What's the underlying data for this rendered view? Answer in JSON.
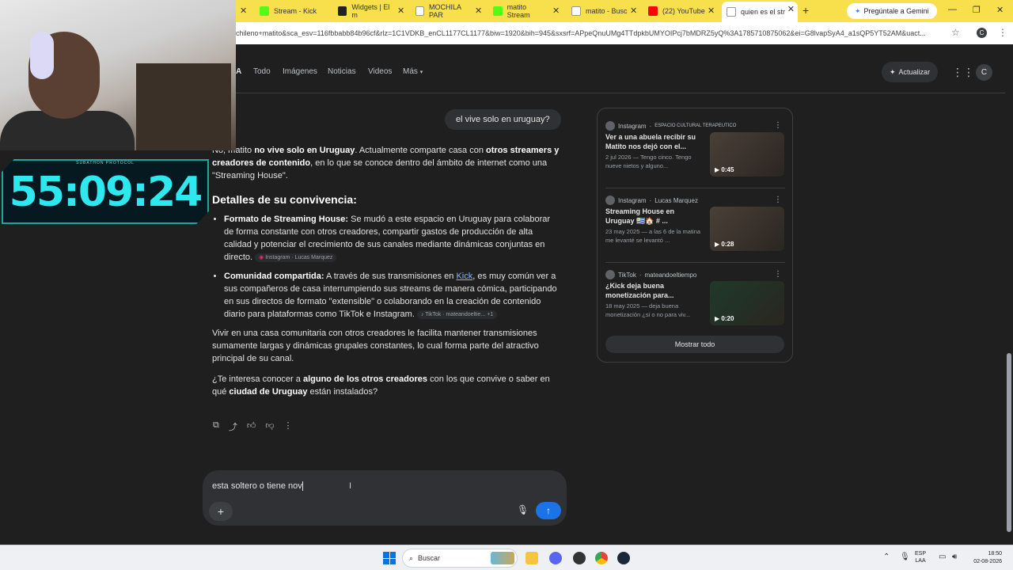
{
  "browser": {
    "tabs": [
      {
        "label": "Stream - Kick",
        "color": "#53fc18"
      },
      {
        "label": "Widgets | El m",
        "color": "#222222"
      },
      {
        "label": "MOCHILA PAR",
        "color": "#4285f4"
      },
      {
        "label": "matito Stream",
        "color": "#53fc18"
      },
      {
        "label": "matito - Busc",
        "color": "#4285f4"
      },
      {
        "label": "(22) YouTube",
        "color": "#ff0000"
      },
      {
        "label": "quien es el str",
        "color": "#4285f4"
      }
    ],
    "gemini_button": "Pregúntale a Gemini",
    "url": "chileno+matito&sca_esv=116fbbabb84b96cf&rlz=1C1VDKB_enCL1177CL1177&biw=1920&bih=945&sxsrf=APpeQnuUMg4TTdpkbUMYOIPcj7bMDRZ5yQ%3A1785710875062&ei=G8lvapSyA4_a1sQP5YT52AM&uact...",
    "profile_letter": "C"
  },
  "header": {
    "logo_fragment": "A",
    "tabs": [
      "Todo",
      "Imágenes",
      "Noticias",
      "Videos",
      "Más"
    ],
    "update_button": "Actualizar",
    "avatar_letter": "C"
  },
  "conversation": {
    "user_question": "el vive solo en uruguay?",
    "answer": {
      "intro_a": "No, matito ",
      "intro_b": "no vive solo en Uruguay",
      "intro_c": ". Actualmente comparte casa con ",
      "intro_d": "otros streamers y creadores de contenido",
      "intro_e": ", en lo que se conoce dentro del ámbito de internet como una \"Streaming House\".",
      "section_heading": "Detalles de su convivencia:",
      "bullet1_bold": "Formato de Streaming House:",
      "bullet1_text": " Se mudó a este espacio en Uruguay para colaborar de forma constante con otros creadores, compartir gastos de producción de alta calidad y potenciar el crecimiento de sus canales mediante dinámicas conjuntas en directo.",
      "bullet1_chip": "Instagram · Lucas Marquez",
      "bullet2_bold": "Comunidad compartida:",
      "bullet2_text_a": " A través de sus transmisiones en ",
      "bullet2_link": "Kick",
      "bullet2_text_b": ", es muy común ver a sus compañeros de casa interrumpiendo sus streams de manera cómica, participando en sus directos de formato \"extensible\" o colaborando en la creación de contenido diario para plataformas como TikTok e Instagram.",
      "bullet2_chip": "TikTok · mateandoeltie...",
      "bullet2_chip_more": "+1",
      "para2": "Vivir en una casa comunitaria con otros creadores le facilita mantener transmisiones sumamente largas y dinámicas grupales constantes, lo cual forma parte del atractivo principal de su canal.",
      "q_a": "¿Te interesa conocer a ",
      "q_b": "alguno de los otros creadores",
      "q_c": " con los que convive o saber en qué ",
      "q_d": "ciudad de Uruguay",
      "q_e": " están instalados?"
    }
  },
  "input": {
    "value": "esta soltero o tiene nov"
  },
  "side_panel": {
    "cards": [
      {
        "source": "Instagram",
        "author": "ESPACIO CULTURAL TERAPEUTICO",
        "title": "Ver a una abuela recibir su Matito nos dejó con el...",
        "desc": "2 jul 2026 — Tengo cinco. Tengo nueve nietos y alguno...",
        "duration": "0:45"
      },
      {
        "source": "Instagram",
        "author": "Lucas Marquez",
        "title": "Streaming House en Uruguay 🇺🇾🏠 # ...",
        "desc": "23 may 2025 — a las 6 de la matina me levanté se levantó ...",
        "duration": "0:28"
      },
      {
        "source": "TikTok",
        "author": "mateandoeltiempo",
        "title": "¿Kick deja buena monetización para...",
        "desc": "18 may 2025 — deja buena monetización ¿si o no para viv...",
        "duration": "0:20"
      }
    ],
    "show_all": "Mostrar todo"
  },
  "overlay": {
    "timer_caption": "SUBATHON PROTOCOL",
    "timer": "55:09:24"
  },
  "taskbar": {
    "search": "Buscar",
    "lang_top": "ESP",
    "lang_bottom": "LAA",
    "time": "18:50",
    "date": "02-08-2026"
  }
}
